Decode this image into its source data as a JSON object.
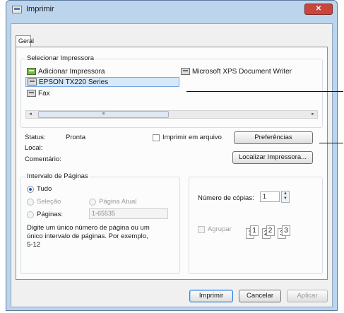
{
  "window": {
    "title": "Imprimir",
    "close_symbol": "✕"
  },
  "tab": {
    "label": "Geral"
  },
  "printer_group": {
    "title": "Selecionar Impressora",
    "printers": [
      "Adicionar Impressora",
      "EPSON TX220 Series",
      "Fax",
      "Microsoft XPS Document Writer"
    ],
    "selected_printer": "EPSON TX220 Series",
    "scroll_left": "◂",
    "scroll_right": "▸",
    "scroll_thumb": "≡"
  },
  "status": {
    "status_label": "Status:",
    "status_value": "Pronta",
    "local_label": "Local:",
    "comment_label": "Comentário:",
    "print_to_file_label": "Imprimir em arquivo",
    "preferences_button": "Preferências",
    "find_printer_button": "Localizar Impressora..."
  },
  "page_range": {
    "title": "Intervalo de Páginas",
    "all_label": "Tudo",
    "selection_label": "Seleção",
    "current_page_label": "Página Atual",
    "pages_label": "Páginas:",
    "pages_value": "1-65535",
    "help_text_1": "Digite um único número de página ou um",
    "help_text_2": "único intervalo de páginas. Por exemplo,",
    "help_text_3": "5-12",
    "selected_option": "Tudo"
  },
  "copies": {
    "label": "Número de cópias:",
    "value": "1",
    "spinner_up": "▲",
    "spinner_down": "▼",
    "collate_label": "Agrupar",
    "collate_pages": [
      "1",
      "1",
      "2",
      "2",
      "3",
      "3"
    ]
  },
  "footer": {
    "print_button": "Imprimir",
    "cancel_button": "Cancelar",
    "apply_button": "Aplicar"
  }
}
